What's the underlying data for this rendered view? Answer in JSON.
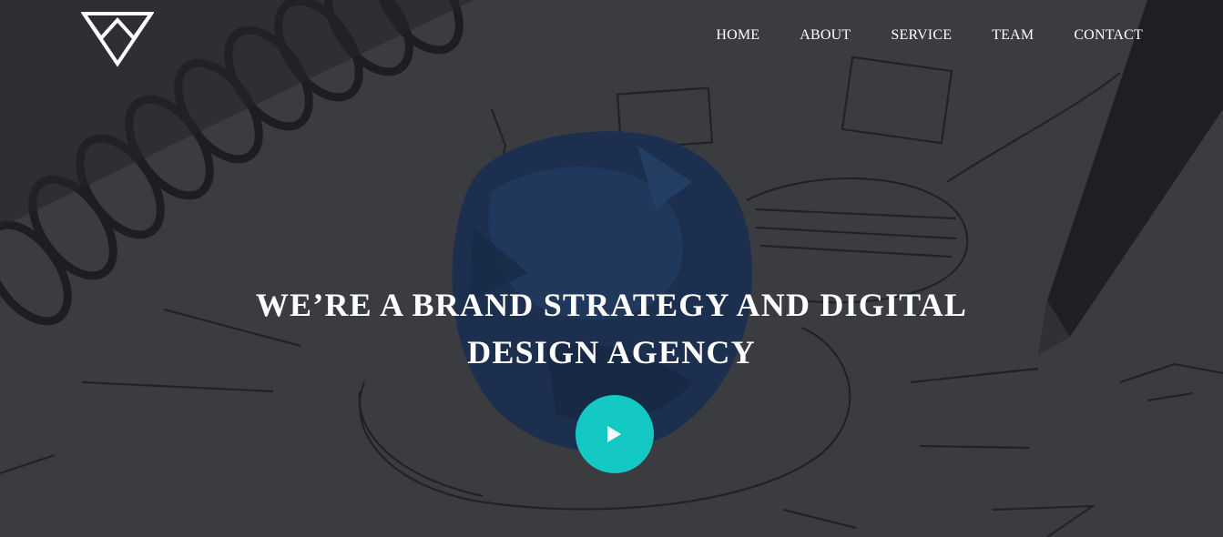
{
  "brand": {
    "logo_icon": "triangle-v-logo-icon"
  },
  "nav": {
    "items": [
      {
        "label": "HOME"
      },
      {
        "label": "ABOUT"
      },
      {
        "label": "SERVICE"
      },
      {
        "label": "TEAM"
      },
      {
        "label": "CONTACT"
      }
    ]
  },
  "hero": {
    "headline_line1": "WE’RE A BRAND STRATEGY AND DIGITAL",
    "headline_line2": "DESIGN AGENCY",
    "play_icon": "play-icon",
    "accent_color": "#14c9c3"
  }
}
